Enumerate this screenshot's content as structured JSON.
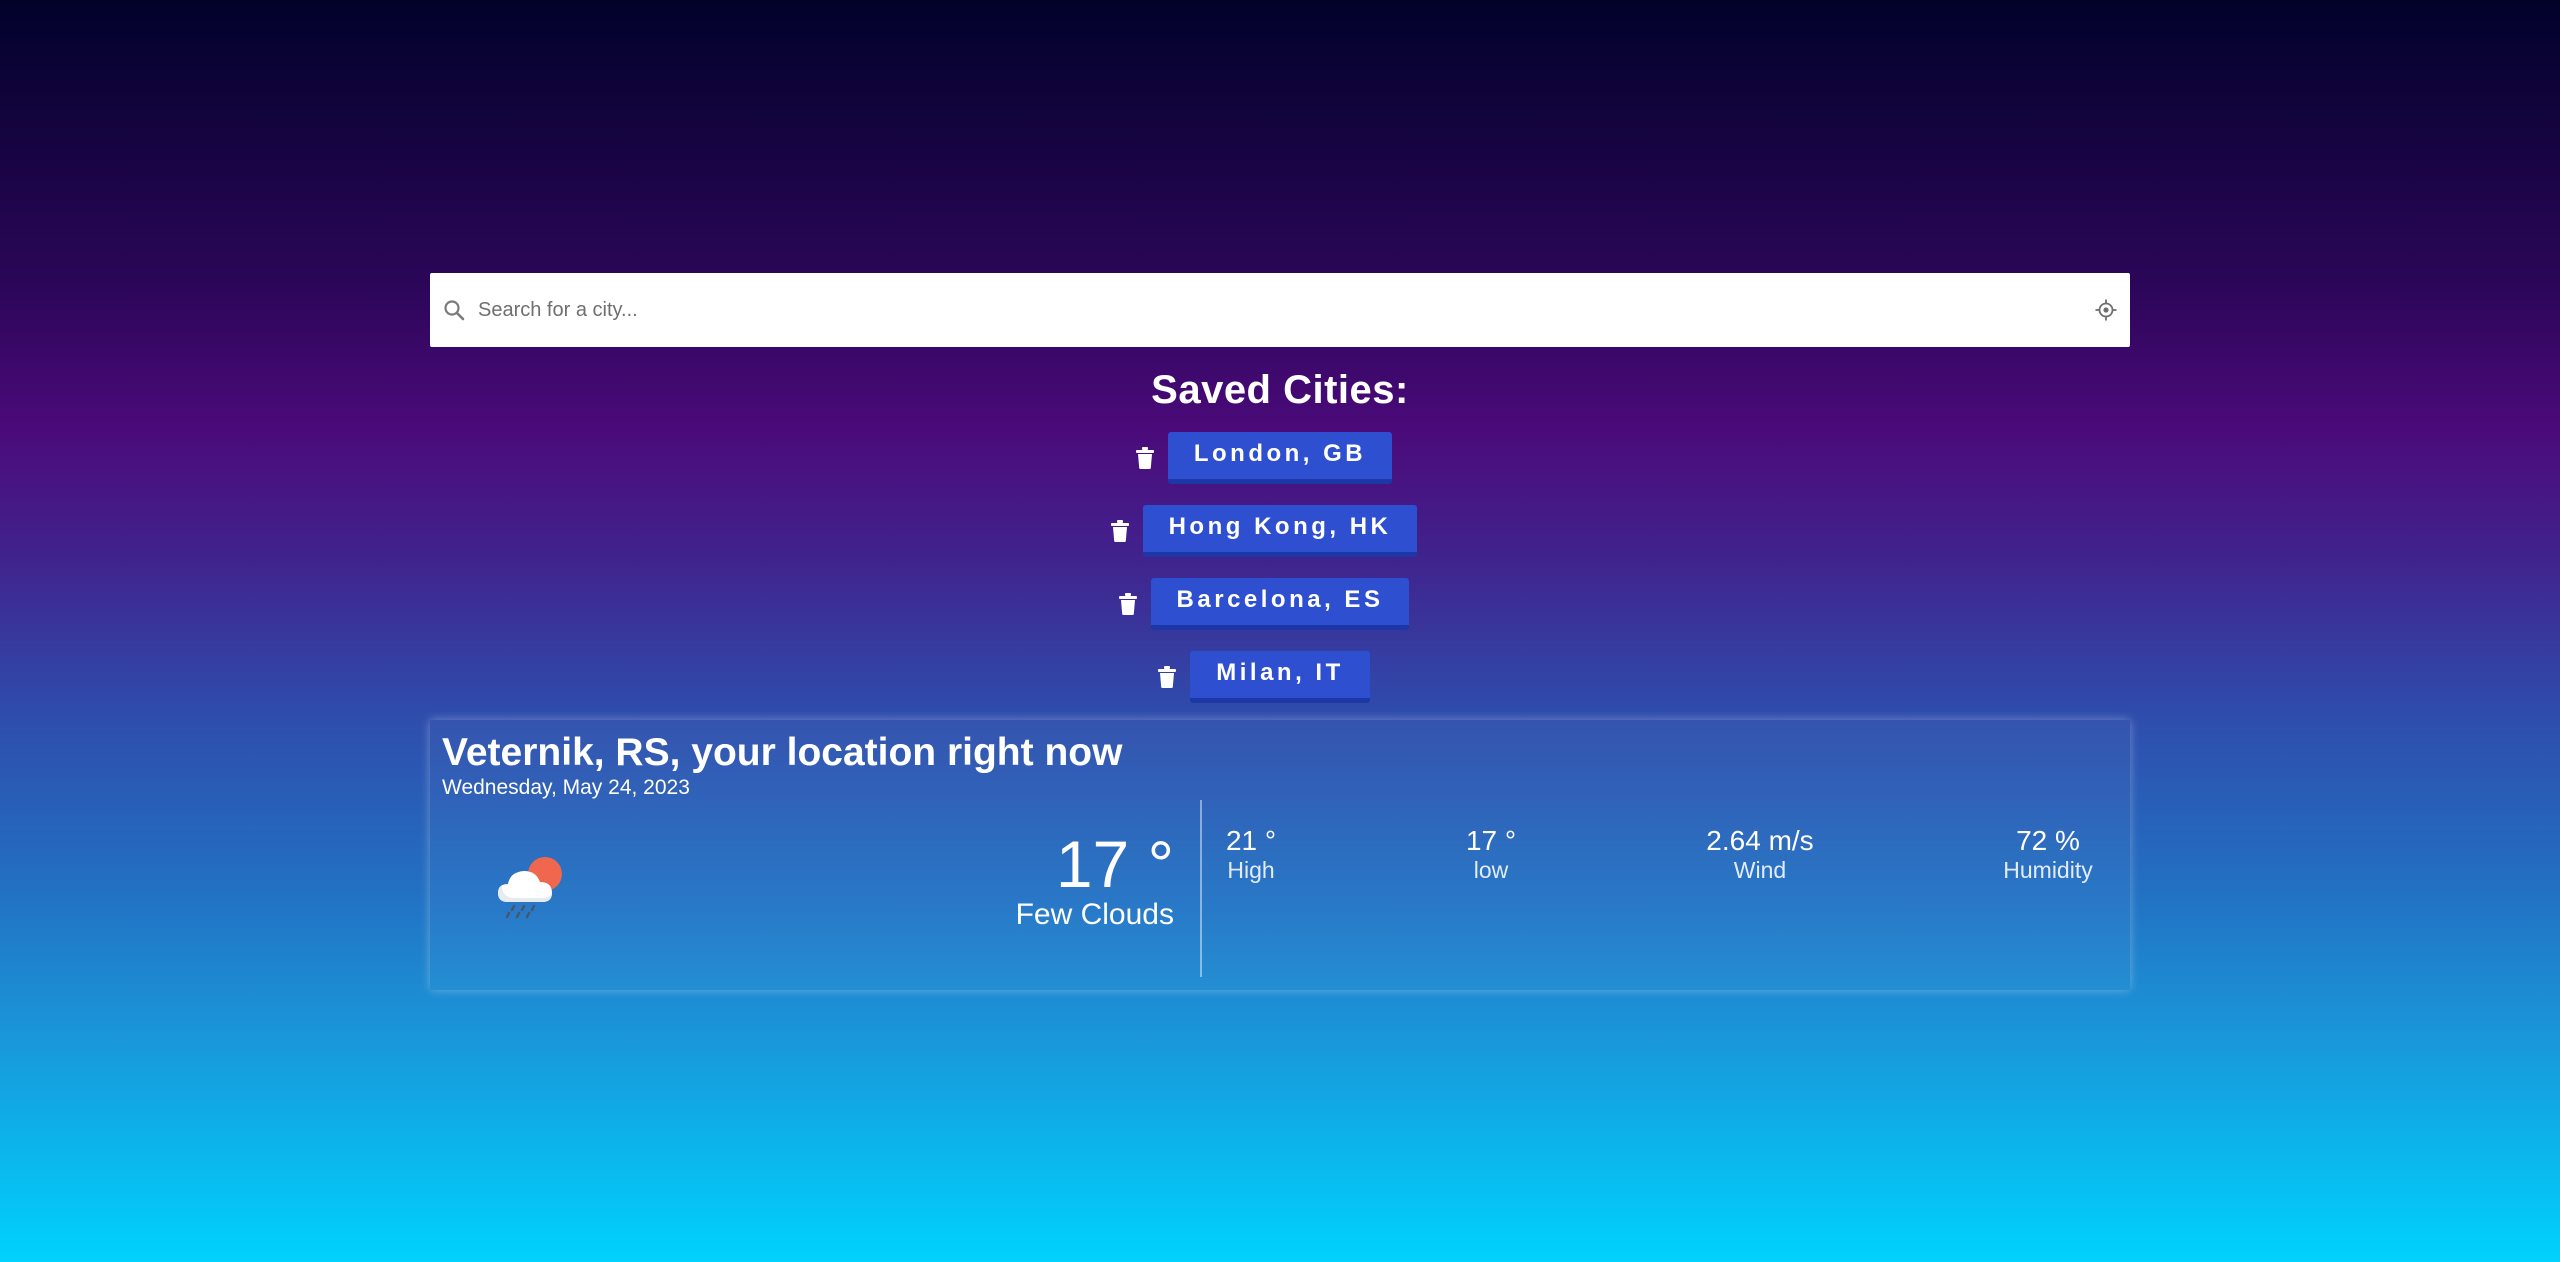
{
  "search": {
    "placeholder": "Search for a city...",
    "value": ""
  },
  "saved": {
    "title": "Saved Cities:",
    "cities": [
      {
        "label": "London, GB"
      },
      {
        "label": "Hong Kong, HK"
      },
      {
        "label": "Barcelona, ES"
      },
      {
        "label": "Milan, IT"
      }
    ]
  },
  "weather": {
    "title": "Veternik, RS, your location right now",
    "date": "Wednesday, May 24, 2023",
    "temperature": "17 °",
    "condition": "Few Clouds",
    "icon": "cloud-rain-sun-icon",
    "stats": [
      {
        "value": "21 °",
        "label": "High"
      },
      {
        "value": "17 °",
        "label": "low"
      },
      {
        "value": "2.64 m/s",
        "label": "Wind"
      },
      {
        "value": "72 %",
        "label": "Humidity"
      }
    ]
  },
  "colors": {
    "button": "#2e4fd0",
    "button_border": "#1d37a6",
    "sun": "#f0674f",
    "gradient_top": "#01022a",
    "gradient_bottom": "#00d2fd"
  }
}
